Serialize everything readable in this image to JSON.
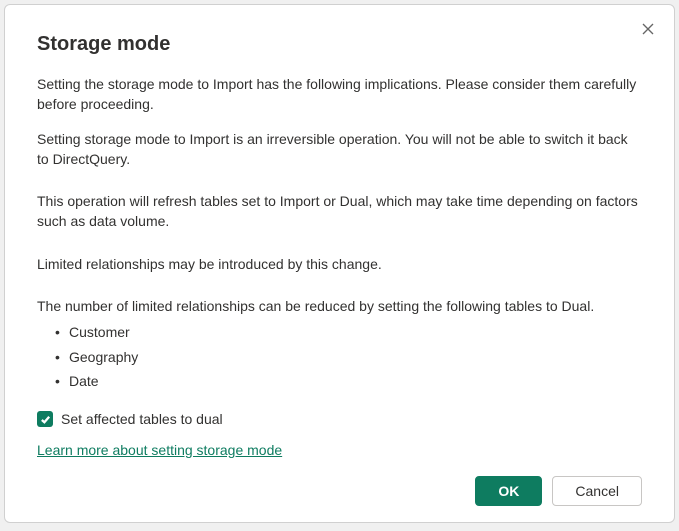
{
  "dialog": {
    "title": "Storage mode",
    "paragraphs": {
      "intro": "Setting the storage mode to Import has the following implications. Please consider them carefully before proceeding.",
      "irreversible": "Setting storage mode to Import is an irreversible operation.  You will not be able to switch it back to DirectQuery.",
      "refresh": "This operation will refresh tables set to Import or Dual, which may take time depending on factors such as data volume.",
      "limited": "Limited relationships may be introduced by this change.",
      "reduce": "The number of limited relationships can be reduced by setting the following tables to Dual."
    },
    "tables": [
      "Customer",
      "Geography",
      "Date"
    ],
    "checkbox": {
      "label": "Set affected tables to dual",
      "checked": true
    },
    "link": "Learn more about setting storage mode",
    "buttons": {
      "ok": "OK",
      "cancel": "Cancel"
    }
  }
}
